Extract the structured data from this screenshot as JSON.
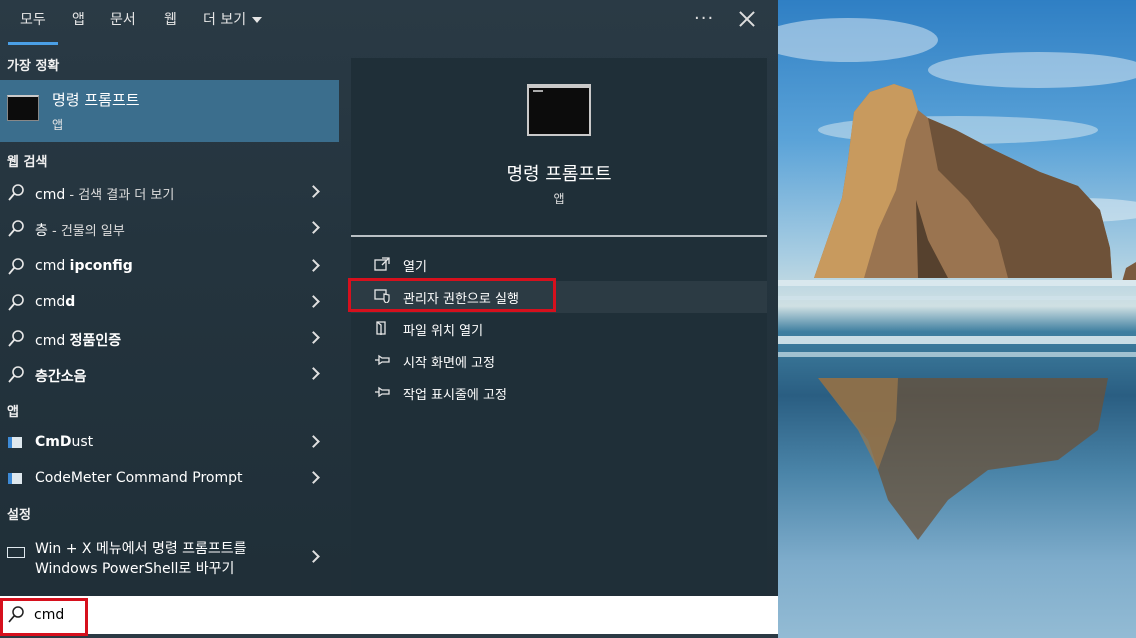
{
  "tabs": [
    {
      "label": "모두"
    },
    {
      "label": "앱"
    },
    {
      "label": "문서"
    },
    {
      "label": "웹"
    },
    {
      "label": "더 보기"
    }
  ],
  "top_actions": {
    "more": "···"
  },
  "best_match": {
    "heading": "가장 정확",
    "name": "명령 프롬프트",
    "type": "앱"
  },
  "web_search": {
    "heading": "웹 검색",
    "items": [
      {
        "query": "cmd",
        "suffix": " - 검색 결과 더 보기"
      },
      {
        "query": "층",
        "suffix": " - 건물의 일부"
      },
      {
        "prefix": "cmd ",
        "bold": "ipconfig"
      },
      {
        "prefix": "cmd",
        "bold": "d"
      },
      {
        "prefix": "cmd ",
        "bold": "정품인증"
      },
      {
        "prefix": "",
        "bold": "층간소음"
      }
    ]
  },
  "apps": {
    "heading": "앱",
    "items": [
      {
        "bold": "CmD",
        "rest": "ust"
      },
      {
        "bold": "",
        "rest": "CodeMeter Command Prompt"
      }
    ]
  },
  "settings": {
    "heading": "설정",
    "line1": "Win + X 메뉴에서 명령 프롬프트를",
    "line2": "Windows PowerShell로 바꾸기"
  },
  "detail": {
    "title": "명령 프롬프트",
    "type": "앱",
    "actions": [
      {
        "label": "열기",
        "icon": "open-icon"
      },
      {
        "label": "관리자 권한으로 실행",
        "icon": "shield-icon"
      },
      {
        "label": "파일 위치 열기",
        "icon": "file-location-icon"
      },
      {
        "label": "시작 화면에 고정",
        "icon": "pin-icon"
      },
      {
        "label": "작업 표시줄에 고정",
        "icon": "pin-icon"
      }
    ]
  },
  "search": {
    "value": "cmd"
  },
  "colors": {
    "accent": "#4a9fe6",
    "highlight": "#3b6e8d",
    "annotation_red": "#d6101d"
  }
}
